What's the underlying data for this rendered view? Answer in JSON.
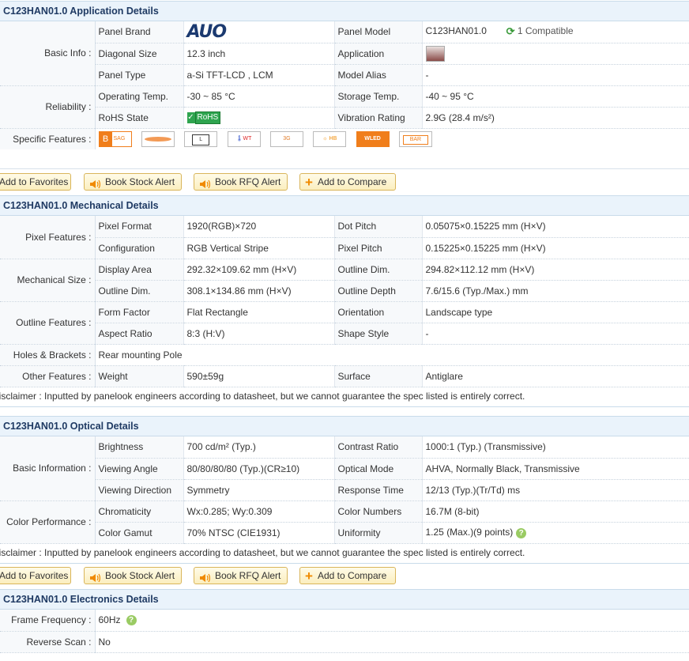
{
  "app": {
    "title": "C123HAN01.0 Application Details",
    "rows": [
      {
        "cat": "Basic Info :",
        "l1": "Panel Brand",
        "v1": "AUO",
        "l2": "Panel Model",
        "v2": "C123HAN01.0",
        "compat": "1 Compatible"
      },
      {
        "cat": "",
        "l1": "Diagonal Size",
        "v1": "12.3 inch",
        "l2": "Application",
        "v2": ""
      },
      {
        "cat": "",
        "l1": "Panel Type",
        "v1": "a-Si TFT-LCD , LCM",
        "l2": "Model Alias",
        "v2": "-"
      },
      {
        "cat": "Reliability :",
        "l1": "Operating Temp.",
        "v1": "-30 ~ 85 °C",
        "l2": "Storage Temp.",
        "v2": "-40 ~ 95 °C"
      },
      {
        "cat": "",
        "l1": "RoHS State",
        "v1": "RoHS",
        "l2": "Vibration Rating",
        "v2": "2.9G (28.4 m/s²)"
      }
    ],
    "features_label": "Specific Features :",
    "features": [
      {
        "icon": "b-sag-icon",
        "text": "B SAG"
      },
      {
        "icon": "curved-icon",
        "text": ""
      },
      {
        "icon": "l-icon",
        "text": "L"
      },
      {
        "icon": "wide-temp-icon",
        "text": "WT"
      },
      {
        "icon": "3g-vibration-icon",
        "text": "3G"
      },
      {
        "icon": "high-brightness-icon",
        "text": "HB"
      },
      {
        "icon": "wled-icon",
        "text": "WLED"
      },
      {
        "icon": "bar-icon",
        "text": "BAR"
      }
    ]
  },
  "buttons": {
    "fav": "Add to Favorites",
    "stock": "Book Stock Alert",
    "rfq": "Book RFQ Alert",
    "compare": "Add to Compare"
  },
  "mech": {
    "title": "C123HAN01.0 Mechanical Details",
    "rows": [
      {
        "cat": "Pixel Features :",
        "l1": "Pixel Format",
        "v1": "1920(RGB)×720",
        "l2": "Dot Pitch",
        "v2": "0.05075×0.15225 mm (H×V)"
      },
      {
        "cat": "",
        "l1": "Configuration",
        "v1": "RGB Vertical Stripe",
        "l2": "Pixel Pitch",
        "v2": "0.15225×0.15225 mm (H×V)"
      },
      {
        "cat": "Mechanical Size :",
        "l1": "Display Area",
        "v1": "292.32×109.62 mm (H×V)",
        "l2": "Outline Dim.",
        "v2": "294.82×112.12 mm (H×V)"
      },
      {
        "cat": "",
        "l1": "Outline Dim.",
        "v1": "308.1×134.86 mm (H×V)",
        "l2": "Outline Depth",
        "v2": "7.6/15.6 (Typ./Max.) mm"
      },
      {
        "cat": "Outline Features :",
        "l1": "Form Factor",
        "v1": "Flat Rectangle",
        "l2": "Orientation",
        "v2": "Landscape type"
      },
      {
        "cat": "",
        "l1": "Aspect Ratio",
        "v1": "8:3 (H:V)",
        "l2": "Shape Style",
        "v2": "-"
      },
      {
        "cat": "Holes & Brackets :",
        "l1": "Rear mounting Pole"
      },
      {
        "cat": "Other Features :",
        "l1": "Weight",
        "v1": "590±59g",
        "l2": "Surface",
        "v2": "Antiglare"
      }
    ],
    "disclaimer": "Disclaimer : Inputted by panelook engineers according to datasheet, but we cannot guarantee the spec listed is entirely correct."
  },
  "opt": {
    "title": "C123HAN01.0 Optical Details",
    "rows": [
      {
        "cat": "Basic Information :",
        "l1": "Brightness",
        "v1": "700 cd/m² (Typ.)",
        "l2": "Contrast Ratio",
        "v2": "1000:1 (Typ.) (Transmissive)"
      },
      {
        "cat": "",
        "l1": "Viewing Angle",
        "v1": "80/80/80/80 (Typ.)(CR≥10)",
        "l2": "Optical Mode",
        "v2": "AHVA, Normally Black, Transmissive"
      },
      {
        "cat": "",
        "l1": "Viewing Direction",
        "v1": "Symmetry",
        "l2": "Response Time",
        "v2": "12/13 (Typ.)(Tr/Td) ms"
      },
      {
        "cat": "Color Performance :",
        "l1": "Chromaticity",
        "v1": "Wx:0.285; Wy:0.309",
        "l2": "Color Numbers",
        "v2": "16.7M (8-bit)"
      },
      {
        "cat": "",
        "l1": "Color Gamut",
        "v1": "70% NTSC (CIE1931)",
        "l2": "Uniformity",
        "v2": "1.25 (Max.)(9 points)"
      }
    ],
    "disclaimer": "Disclaimer : Inputted by panelook engineers according to datasheet, but we cannot guarantee the spec listed is entirely correct."
  },
  "elec": {
    "title": "C123HAN01.0 Electronics Details",
    "rows": [
      {
        "cat": "Frame Frequency :",
        "v": "60Hz"
      },
      {
        "cat": "Reverse Scan :",
        "v": "No"
      }
    ]
  },
  "colors": {
    "header_bg": "#eaf3fb",
    "header_text": "#1f3a63",
    "button_border": "#d9b55a",
    "accent": "#f08a00"
  }
}
